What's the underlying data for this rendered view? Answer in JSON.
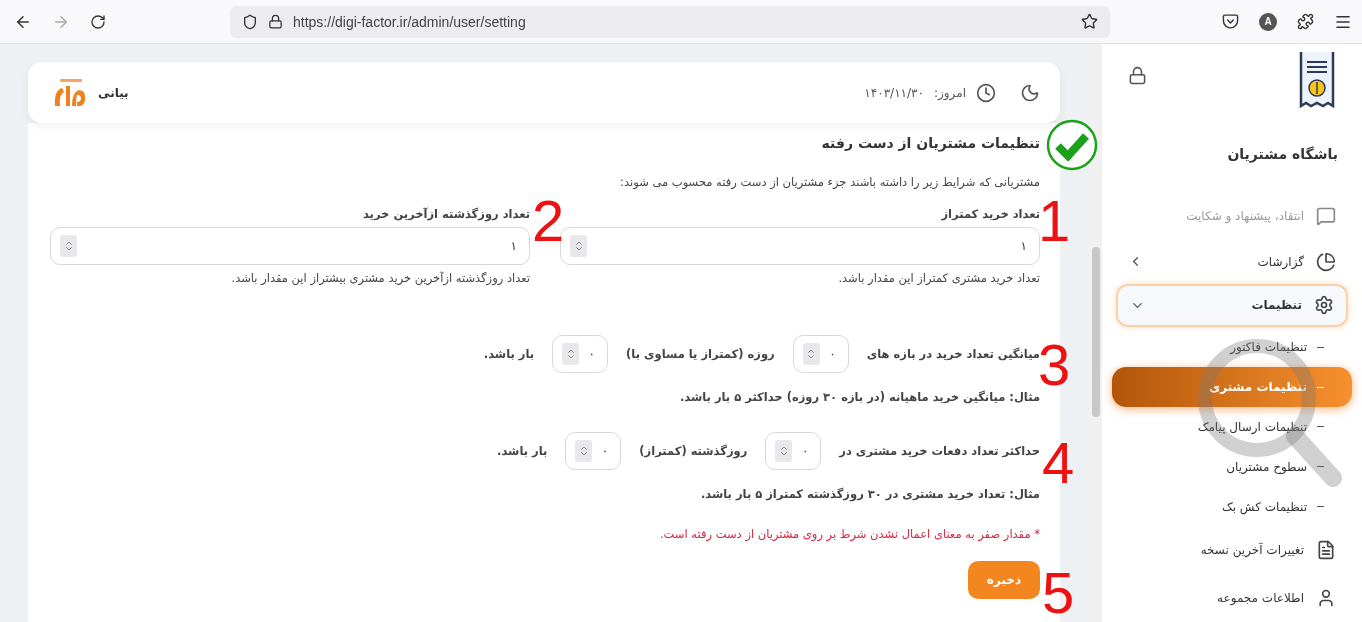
{
  "browser": {
    "url": "https://digi-factor.ir/admin/user/setting",
    "profile": "A"
  },
  "header": {
    "date_label": "امروز:",
    "date": "۱۴۰۳/۱۱/۳۰",
    "brand": "بیانی"
  },
  "form": {
    "title": "تنظیمات مشتریان از دست رفته",
    "intro": "مشتریانی که شرایط زیر را داشته باشند جزء مشتریان از دست رفته محسوب می شوند:",
    "fields": [
      {
        "label": "تعداد خرید کمتراز",
        "value": "۱",
        "help": "تعداد خرید مشتری کمتراز این مقدار باشد."
      },
      {
        "label": "تعداد روزگذشته ازآخرین خرید",
        "value": "۱",
        "help": "تعداد روزگذشته ازآخرین خرید مشتری بیشتراز این مقدار باشد."
      }
    ],
    "rules": [
      {
        "parts": [
          {
            "kind": "text",
            "text": "میانگین تعداد خرید در بازه های"
          },
          {
            "kind": "input",
            "value": "۰"
          },
          {
            "kind": "text",
            "text": "روزه (کمتراز یا مساوی با)"
          },
          {
            "kind": "input",
            "value": "۰"
          },
          {
            "kind": "text",
            "text": "بار باشد."
          }
        ],
        "example": "مثال: میانگین خرید ماهیانه (در بازه ۳۰ روزه) حداکثر ۵ بار باشد."
      },
      {
        "parts": [
          {
            "kind": "text",
            "text": "حداکثر تعداد دفعات خرید مشتری در"
          },
          {
            "kind": "input",
            "value": "۰"
          },
          {
            "kind": "text",
            "text": "روزگذشته (کمتراز)"
          },
          {
            "kind": "input",
            "value": "۰"
          },
          {
            "kind": "text",
            "text": "بار باشد."
          }
        ],
        "example": "مثال: تعداد خرید مشتری در ۳۰ روزگذشته کمتراز ۵ بار باشد."
      }
    ],
    "note": "* مقدار صفر به معنای اعمال نشدن شرط بر روی مشتریان از دست رفته است.",
    "save": "ذخیره"
  },
  "annotations": [
    {
      "kind": "check"
    },
    {
      "kind": "number",
      "text": "1"
    },
    {
      "kind": "number",
      "text": "2"
    },
    {
      "kind": "number",
      "text": "3"
    },
    {
      "kind": "number",
      "text": "4"
    },
    {
      "kind": "number",
      "text": "5"
    },
    {
      "kind": "magnifier"
    }
  ],
  "sidebar": {
    "title": "باشگاه مشتریان",
    "items": [
      {
        "label": "انتقاد، پیشنهاد و شکایت",
        "disabled": true
      },
      {
        "label": "گزارشات",
        "disabled": false,
        "expanded": false
      },
      {
        "label": "تنظیمات",
        "disabled": false,
        "expanded": true,
        "children": [
          {
            "label": "تنظیمات فاکتور",
            "selected": false
          },
          {
            "label": "تنظیمات مشتری",
            "selected": true
          },
          {
            "label": "تنظیمات ارسال پیامک",
            "selected": false
          },
          {
            "label": "سطوح مشتریان",
            "selected": false
          },
          {
            "label": "تنظیمات کش بک",
            "selected": false
          }
        ]
      },
      {
        "label": "تغییرات آخرین نسخه",
        "disabled": false
      },
      {
        "label": "اطلاعات مجموعه",
        "disabled": false
      }
    ]
  }
}
